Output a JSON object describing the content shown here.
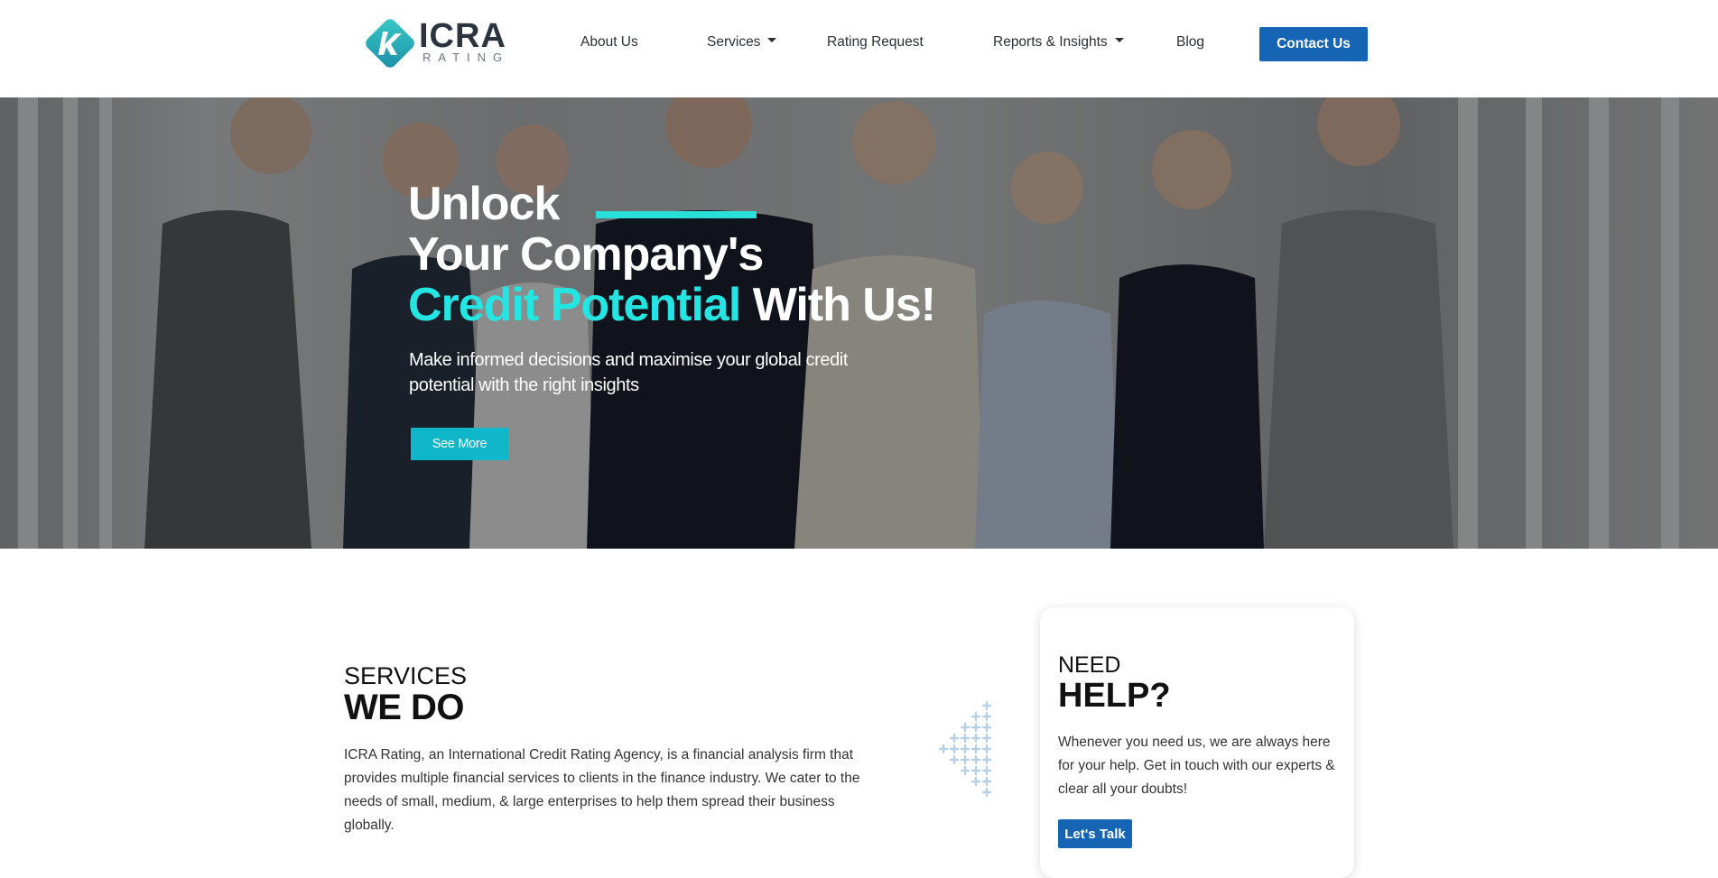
{
  "header": {
    "logo": {
      "word": "ICRA",
      "sub": "RATING"
    },
    "nav": [
      {
        "label": "About Us",
        "has_dropdown": false
      },
      {
        "label": "Services",
        "has_dropdown": true
      },
      {
        "label": "Rating Request",
        "has_dropdown": false
      },
      {
        "label": "Reports & Insights",
        "has_dropdown": true
      },
      {
        "label": "Blog",
        "has_dropdown": false
      }
    ],
    "contact_label": "Contact Us"
  },
  "hero": {
    "title_line1": "Unlock",
    "title_line2": "Your Company's",
    "title_accent": "Credit Potential",
    "title_line3_rest": " With Us!",
    "subtitle": "Make informed decisions and maximise your global credit potential with the right insights",
    "cta_label": "See More"
  },
  "services": {
    "kicker": "SERVICES",
    "title": "WE DO",
    "body": "ICRA Rating, an International Credit Rating Agency, is a financial analysis firm that provides multiple financial services to clients in the finance industry. We cater to the needs of small, medium, & large enterprises to help them spread their business globally."
  },
  "help": {
    "kicker": "NEED",
    "title": "HELP?",
    "body": "Whenever you need us, we are always here for your help. Get in touch with our experts & clear all your doubts!",
    "cta_label": "Let's Talk"
  },
  "colors": {
    "brand_blue": "#1565b4",
    "accent_cyan": "#24e5e2",
    "cta_teal": "#0fb7c8"
  }
}
